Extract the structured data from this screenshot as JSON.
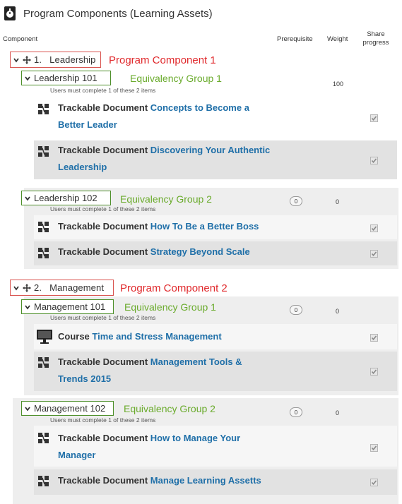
{
  "title": "Program Components (Learning Assets)",
  "columns": {
    "component": "Component",
    "prerequisite": "Prerequisite",
    "weight": "Weight",
    "share_progress": "Share progress"
  },
  "components": [
    {
      "label": "1.   Leadership",
      "annotation": "Program Component 1",
      "groups": [
        {
          "label": "Leadership 101",
          "annotation": "Equivalency Group 1",
          "note": "Users must complete 1 of these 2 items",
          "prerequisite": "",
          "weight": "100",
          "assets": [
            {
              "type": "Trackable Document",
              "title": "Concepts to Become a Better Leader"
            },
            {
              "type": "Trackable Document",
              "title": "Discovering Your Authentic Leadership"
            }
          ]
        },
        {
          "label": "Leadership 102",
          "annotation": "Equivalency Group 2",
          "note": "Users must complete 1 of these 2 items",
          "prerequisite": "0",
          "weight": "0",
          "assets": [
            {
              "type": "Trackable Document",
              "title": "How To Be a Better Boss"
            },
            {
              "type": "Trackable Document",
              "title": "Strategy Beyond Scale"
            }
          ]
        }
      ]
    },
    {
      "label": "2.   Management",
      "annotation": "Program Component 2",
      "groups": [
        {
          "label": "Management 101",
          "annotation": "Equivalency Group 1",
          "note": "Users must complete 1 of these 2 items",
          "prerequisite": "0",
          "weight": "0",
          "assets": [
            {
              "type": "Course",
              "title": "Time and Stress Management"
            },
            {
              "type": "Trackable Document",
              "title": "Management Tools & Trends 2015"
            }
          ]
        },
        {
          "label": "Management 102",
          "annotation": "Equivalency Group 2",
          "note": "Users must complete 1 of these 2 items",
          "prerequisite": "0",
          "weight": "0",
          "assets": [
            {
              "type": "Trackable Document",
              "title": "How to Manage Your Manager"
            },
            {
              "type": "Trackable Document",
              "title": "Manage Learning Assetts"
            }
          ]
        }
      ]
    }
  ],
  "icons": {
    "header": "stopwatch-icon",
    "expand": "chevron-down-icon",
    "move": "move-icon",
    "trackable_document": "trackable-document-icon",
    "course": "monitor-icon",
    "share_checkbox": "checkbox-checked-icon"
  },
  "colors": {
    "component_border": "#d9534f",
    "component_annotation": "#e0282b",
    "group_border": "#4d8f2a",
    "group_annotation": "#6aab2c",
    "link": "#1f6fa8",
    "panel_bg": "#eeeeee",
    "row_bg": "#e2e2e2"
  }
}
